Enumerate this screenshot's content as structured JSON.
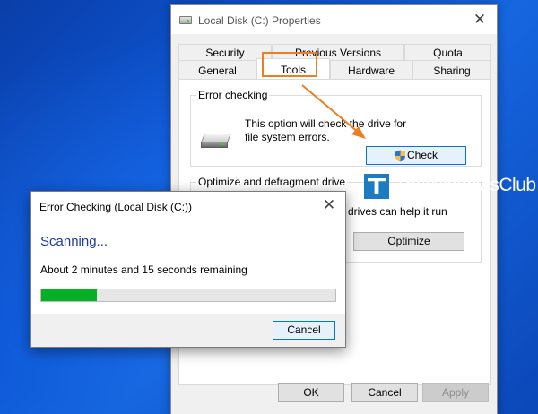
{
  "properties_window": {
    "title": "Local Disk (C:) Properties",
    "close_glyph": "✕",
    "tabs_row1": [
      "Security",
      "Previous Versions",
      "Quota"
    ],
    "tabs_row2": [
      "General",
      "Tools",
      "Hardware",
      "Sharing"
    ],
    "active_tab": "Tools",
    "error_checking": {
      "title": "Error checking",
      "description": "This option will check the drive for file system errors.",
      "check_label": "Check"
    },
    "optimize": {
      "title": "Optimize and defragment drive",
      "description_fragment": "drives can help it run",
      "optimize_label": "Optimize"
    },
    "buttons": {
      "ok": "OK",
      "cancel": "Cancel",
      "apply": "Apply"
    }
  },
  "error_dialog": {
    "title": "Error Checking (Local Disk (C:))",
    "close_glyph": "✕",
    "status": "Scanning...",
    "remaining": "About 2 minutes and 15 seconds remaining",
    "progress_fraction": 0.19,
    "cancel_label": "Cancel"
  },
  "watermark": {
    "text": "TheWindowsClub"
  },
  "colors": {
    "annotation": "#ef7d22",
    "progress": "#06b025",
    "scanning_text": "#1e3b9b",
    "focus_border": "#0078d7",
    "desktop": "#0d57d6"
  },
  "icons": [
    "disk-icon",
    "shield-icon",
    "close-icon",
    "arrow-icon",
    "windows-club-logo"
  ]
}
